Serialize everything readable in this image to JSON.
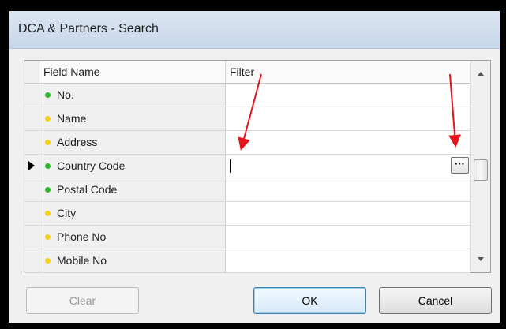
{
  "window": {
    "title": "DCA & Partners - Search"
  },
  "grid": {
    "columns": [
      "Field Name",
      "Filter"
    ],
    "current_row": 3,
    "rows": [
      {
        "name": "No.",
        "indicator": "green",
        "filter": ""
      },
      {
        "name": "Name",
        "indicator": "yellow",
        "filter": ""
      },
      {
        "name": "Address",
        "indicator": "yellow",
        "filter": ""
      },
      {
        "name": "Country Code",
        "indicator": "green",
        "filter": ""
      },
      {
        "name": "Postal Code",
        "indicator": "green",
        "filter": ""
      },
      {
        "name": "City",
        "indicator": "yellow",
        "filter": ""
      },
      {
        "name": "Phone No",
        "indicator": "yellow",
        "filter": ""
      },
      {
        "name": "Mobile No",
        "indicator": "yellow",
        "filter": ""
      }
    ],
    "lookup_button_label": "···"
  },
  "buttons": {
    "clear": "Clear",
    "ok": "OK",
    "cancel": "Cancel"
  },
  "colors": {
    "green": "#2db82d",
    "yellow": "#f2d21a",
    "annotation_arrow": "#e8141c"
  },
  "icons": {
    "row_pointer": "current-row-pointer-icon",
    "scroll_up": "scroll-up-arrow-icon",
    "scroll_down": "scroll-down-arrow-icon",
    "lookup": "ellipsis-icon"
  }
}
